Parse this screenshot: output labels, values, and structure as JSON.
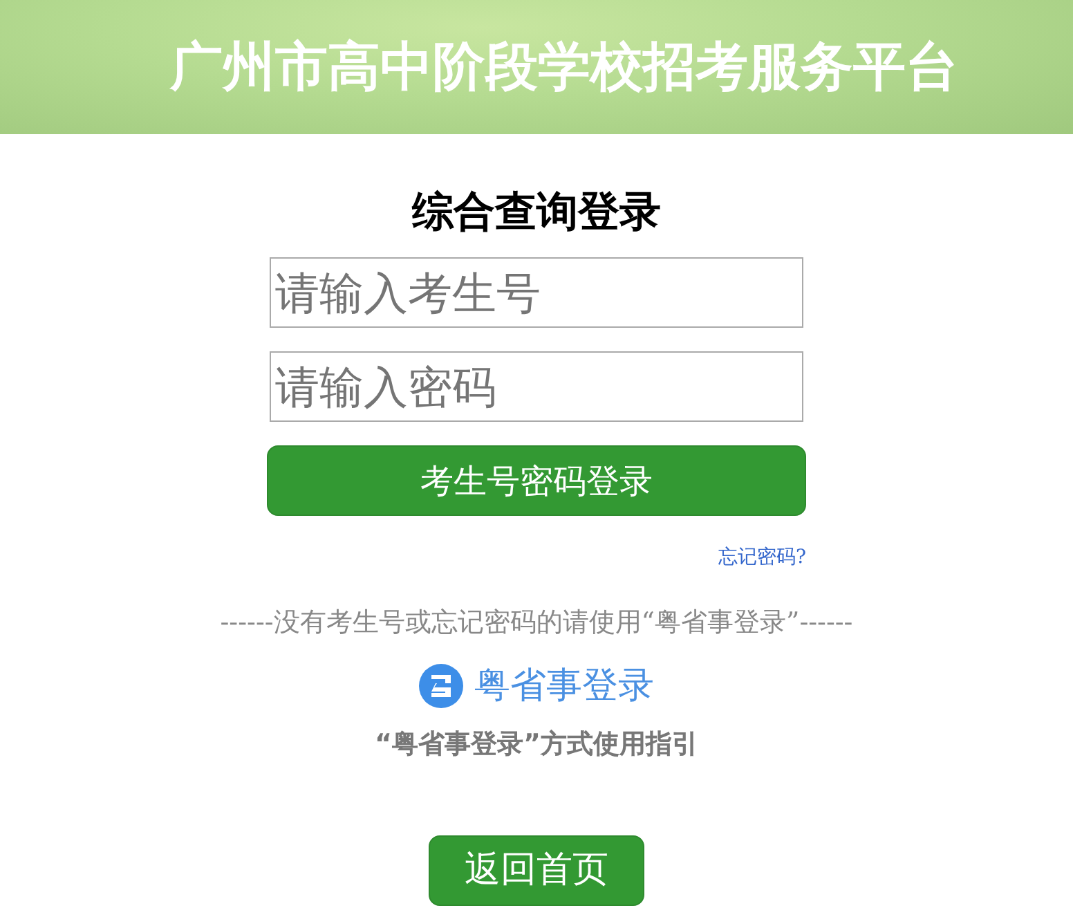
{
  "header": {
    "title": "广州市高中阶段学校招考服务平台"
  },
  "login": {
    "title": "综合查询登录",
    "fields": [
      {
        "placeholder": "请输入考生号"
      },
      {
        "placeholder": "请输入密码"
      }
    ],
    "submit": "考生号密码登录",
    "forgot_link": "忘记密码?",
    "notice": "------没有考生号或忘记密码的请使用“粤省事登录”------",
    "alt_login": "粤省事登录",
    "guide_link": "“粤省事登录”方式使用指引",
    "back_button": "返回首页"
  }
}
